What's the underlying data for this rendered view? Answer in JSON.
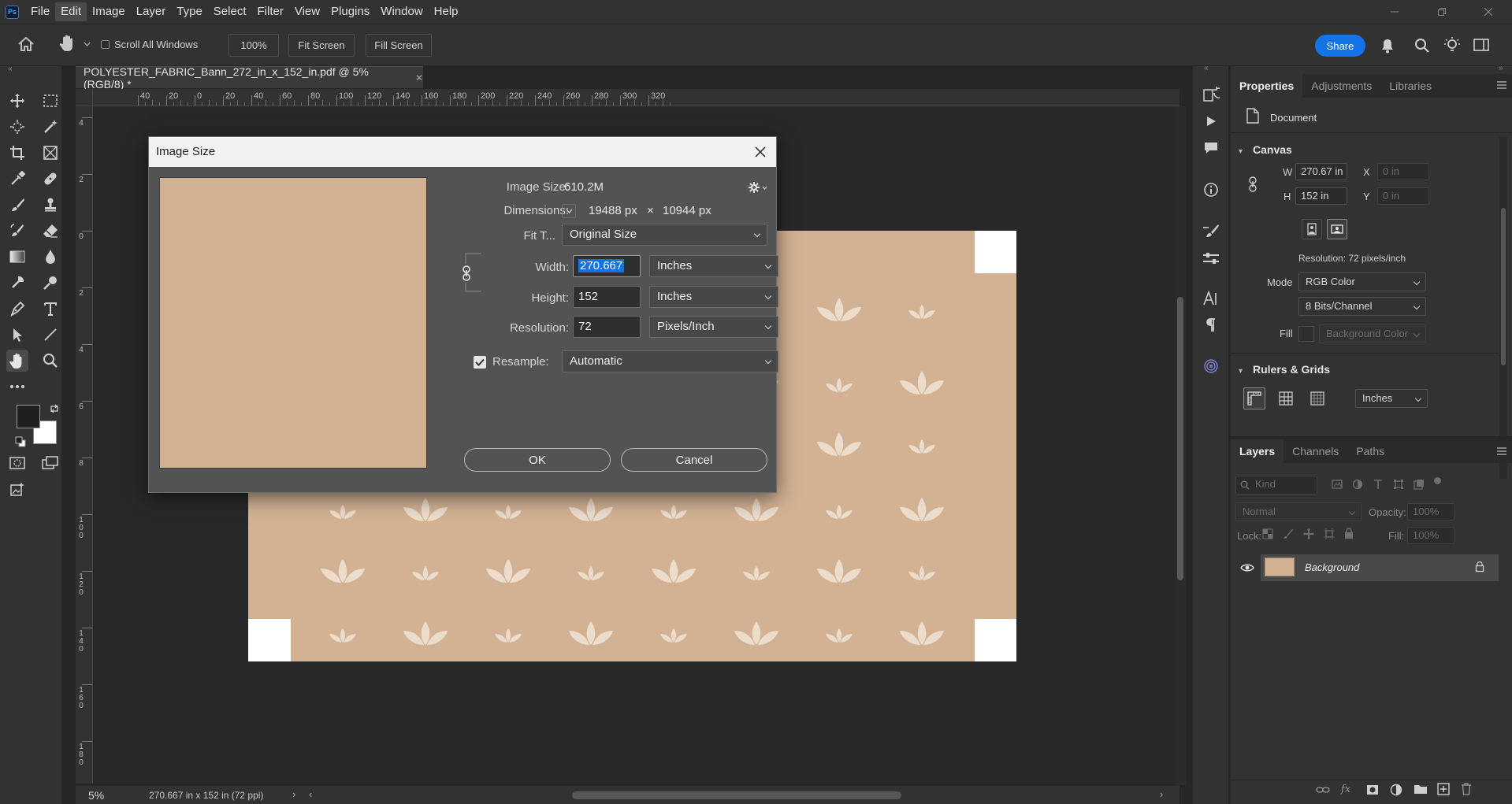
{
  "menubar": {
    "logo": "Ps",
    "items": [
      "File",
      "Edit",
      "Image",
      "Layer",
      "Type",
      "Select",
      "Filter",
      "View",
      "Plugins",
      "Window",
      "Help"
    ],
    "active_item": "Edit"
  },
  "options": {
    "scroll_all_windows": "Scroll All Windows",
    "zoom_value": "100%",
    "fit_screen": "Fit Screen",
    "fill_screen": "Fill Screen",
    "share": "Share"
  },
  "document": {
    "tab_title": "POLYESTER_FABRIC_Bann_272_in_x_152_in.pdf @ 5% (RGB/8) *",
    "ruler_h": [
      "40",
      "20",
      "0",
      "20",
      "40",
      "60",
      "80",
      "100",
      "120",
      "140",
      "160",
      "180",
      "200",
      "220",
      "240",
      "260",
      "280",
      "300",
      "320"
    ],
    "ruler_v": [
      "4",
      "2",
      "0",
      "2",
      "4",
      "6",
      "8",
      "1 0 0",
      "1 2 0",
      "1 4 0",
      "1 6 0",
      "1 8 0"
    ],
    "fabric_color": "#d3b294"
  },
  "status": {
    "zoom": "5%",
    "info": "270.667 in x 152 in (72 ppi)"
  },
  "image_size_dialog": {
    "title": "Image Size",
    "image_size_label": "Image Size:",
    "image_size_value": "610.2M",
    "dimensions_label": "Dimensions:",
    "dim_width": "19488 px",
    "dim_x": "×",
    "dim_height": "10944 px",
    "fit_to_label": "Fit T...",
    "fit_to_value": "Original Size",
    "width_label": "Width:",
    "width_value": "270.667",
    "width_unit": "Inches",
    "height_label": "Height:",
    "height_value": "152",
    "height_unit": "Inches",
    "resolution_label": "Resolution:",
    "resolution_value": "72",
    "resolution_unit": "Pixels/Inch",
    "resample_label": "Resample:",
    "resample_value": "Automatic",
    "ok": "OK",
    "cancel": "Cancel"
  },
  "properties_panel": {
    "tabs": [
      "Properties",
      "Adjustments",
      "Libraries"
    ],
    "active_tab": "Properties",
    "document_label": "Document",
    "canvas_section": "Canvas",
    "w_label": "W",
    "w_value": "270.67 in",
    "h_label": "H",
    "h_value": "152 in",
    "x_label": "X",
    "x_placeholder": "0 in",
    "y_label": "Y",
    "y_placeholder": "0 in",
    "resolution_text": "Resolution: 72 pixels/inch",
    "mode_label": "Mode",
    "mode_value": "RGB Color",
    "bits_value": "8 Bits/Channel",
    "fill_label": "Fill",
    "fill_value": "Background Color",
    "rulers_section": "Rulers & Grids",
    "ruler_unit": "Inches"
  },
  "layers_panel": {
    "tabs": [
      "Layers",
      "Channels",
      "Paths"
    ],
    "active_tab": "Layers",
    "kind_placeholder": "Kind",
    "blend_mode": "Normal",
    "opacity_label": "Opacity:",
    "opacity_value": "100%",
    "lock_label": "Lock:",
    "fill_label": "Fill:",
    "fill_value": "100%",
    "layers": [
      {
        "name": "Background"
      }
    ]
  }
}
